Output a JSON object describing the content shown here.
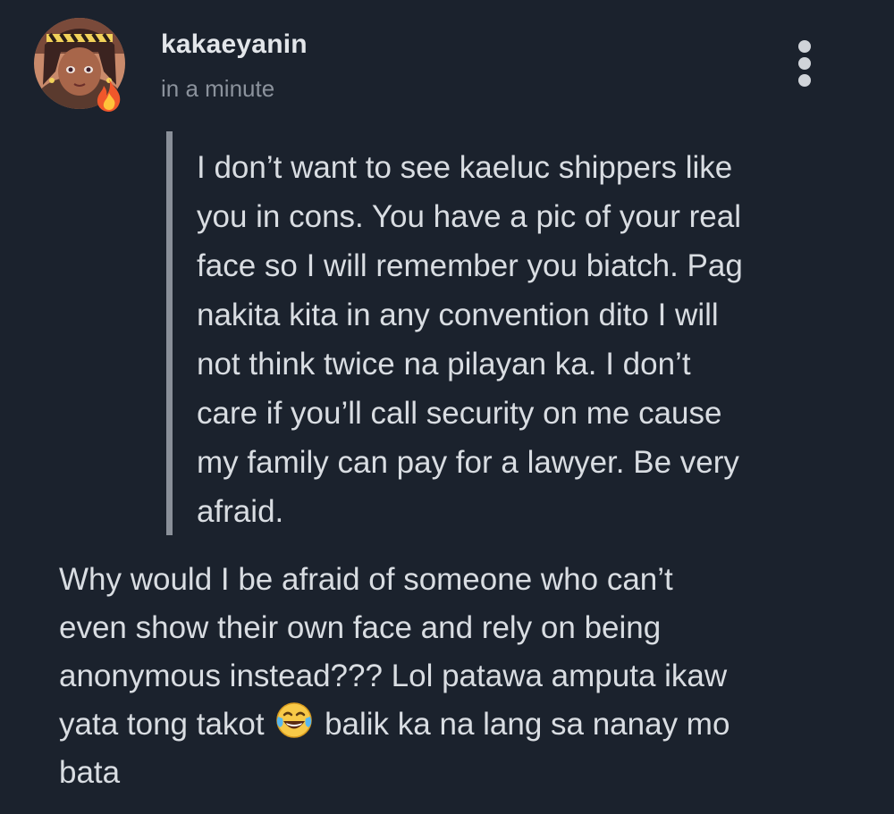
{
  "post": {
    "username": "kakaeyanin",
    "timestamp": "in a minute",
    "more_icon": "more-vertical-icon",
    "quoted_message": {
      "lines": [
        "I don’t want to see kaeluc shippers like",
        "you in cons. You have a pic of your real",
        "face so I will remember you biatch. Pag",
        "nakita kita in any convention dito I will",
        "not think twice na pilayan ka. I don’t",
        "care if you’ll call security on me cause",
        "my family can pay for a lawyer. Be very",
        "afraid."
      ]
    },
    "reply": {
      "lines": [
        "Why would I be afraid of someone who can’t",
        "even show their own face and rely on being",
        "anonymous instead??? Lol patawa amputa ikaw"
      ],
      "line4_before_emoji": "yata tong takot",
      "emoji": "face-with-tears-of-joy-icon",
      "line4_after_emoji": "balik ka na lang sa nanay mo",
      "last_line": "bata"
    }
  },
  "colors": {
    "background": "#1b222d",
    "text": "#d9dde2",
    "muted": "#8b929c",
    "quote_bar": "#8a9099"
  }
}
